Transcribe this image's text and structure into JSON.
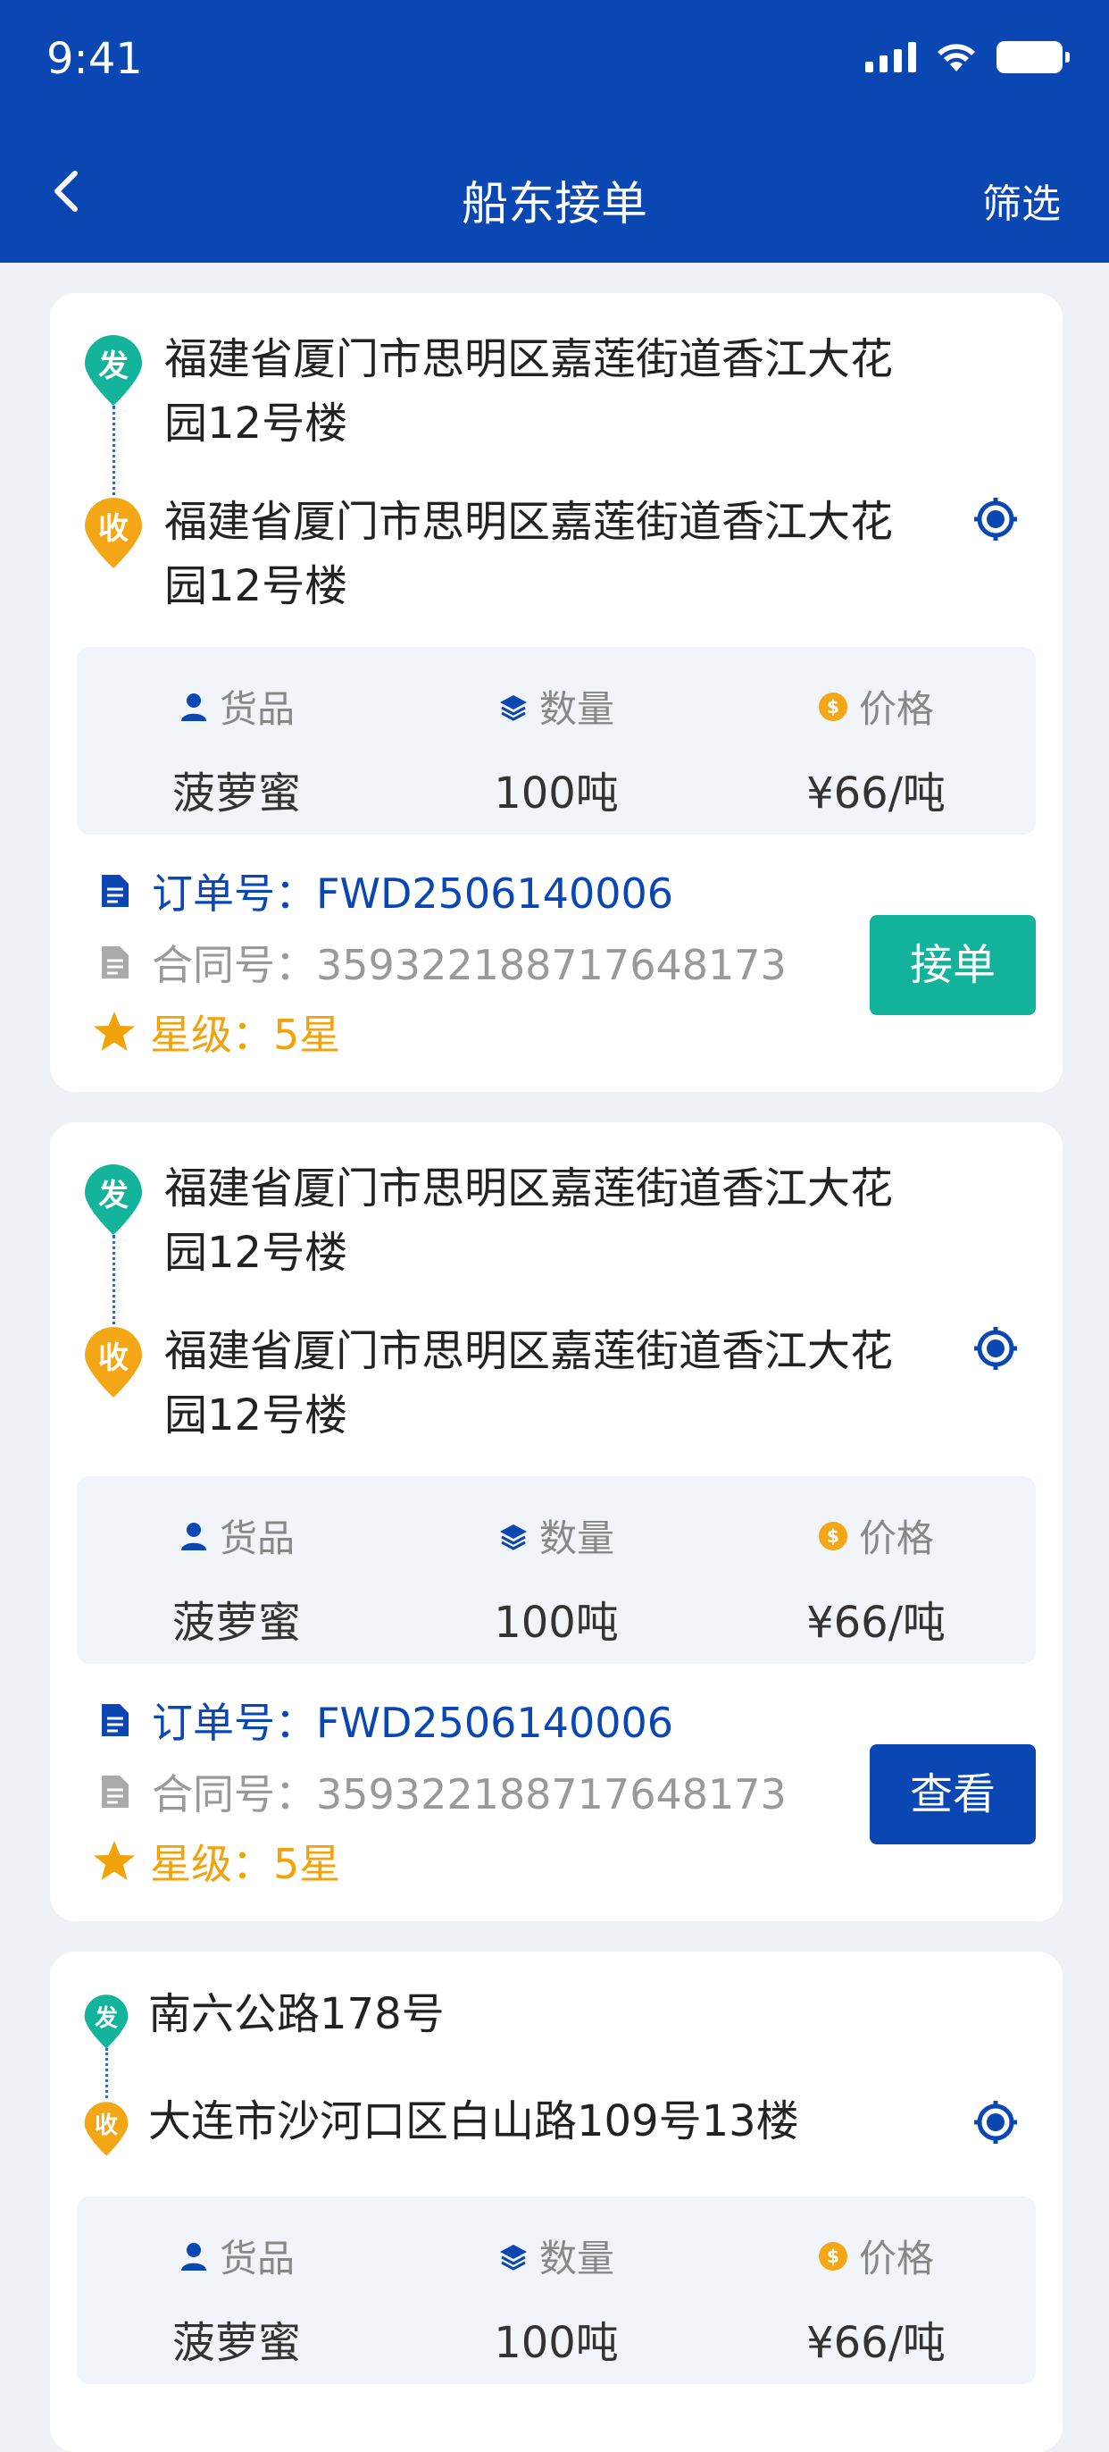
{
  "status_bar": {
    "time": "9:41"
  },
  "nav": {
    "back_icon": "chevron-left-icon",
    "title": "船东接单",
    "filter_label": "筛选"
  },
  "labels": {
    "from_badge": "发",
    "to_badge": "收",
    "goods_header": "货品",
    "quantity_header": "数量",
    "price_header": "价格"
  },
  "colors": {
    "primary": "#0a47b2",
    "green": "#12b39a",
    "orange": "#f0a30a",
    "from_pin": "#14b39b",
    "to_pin": "#f3a716"
  },
  "orders": [
    {
      "from_line1": "福建省厦门市思明区嘉莲街道香江大花",
      "from_line2": "园12号楼",
      "to_line1": "福建省厦门市思明区嘉莲街道香江大花",
      "to_line2": "园12号楼",
      "goods": "菠萝蜜",
      "quantity": "100吨",
      "price": "¥66/吨",
      "order_no": "订单号：FWD2506140006",
      "contract_no": "合同号：359322188717648173",
      "rating": "星级：5星",
      "action": "接单"
    },
    {
      "from_line1": "福建省厦门市思明区嘉莲街道香江大花",
      "from_line2": "园12号楼",
      "to_line1": "福建省厦门市思明区嘉莲街道香江大花",
      "to_line2": "园12号楼",
      "goods": "菠萝蜜",
      "quantity": "100吨",
      "price": "¥66/吨",
      "order_no": "订单号：FWD2506140006",
      "contract_no": "合同号：359322188717648173",
      "rating": "星级：5星",
      "action": "查看"
    },
    {
      "from_line1": "南六公路178号",
      "to_line1": "大连市沙河口区白山路109号13楼",
      "goods": "菠萝蜜",
      "quantity": "100吨",
      "price": "¥66/吨"
    }
  ]
}
